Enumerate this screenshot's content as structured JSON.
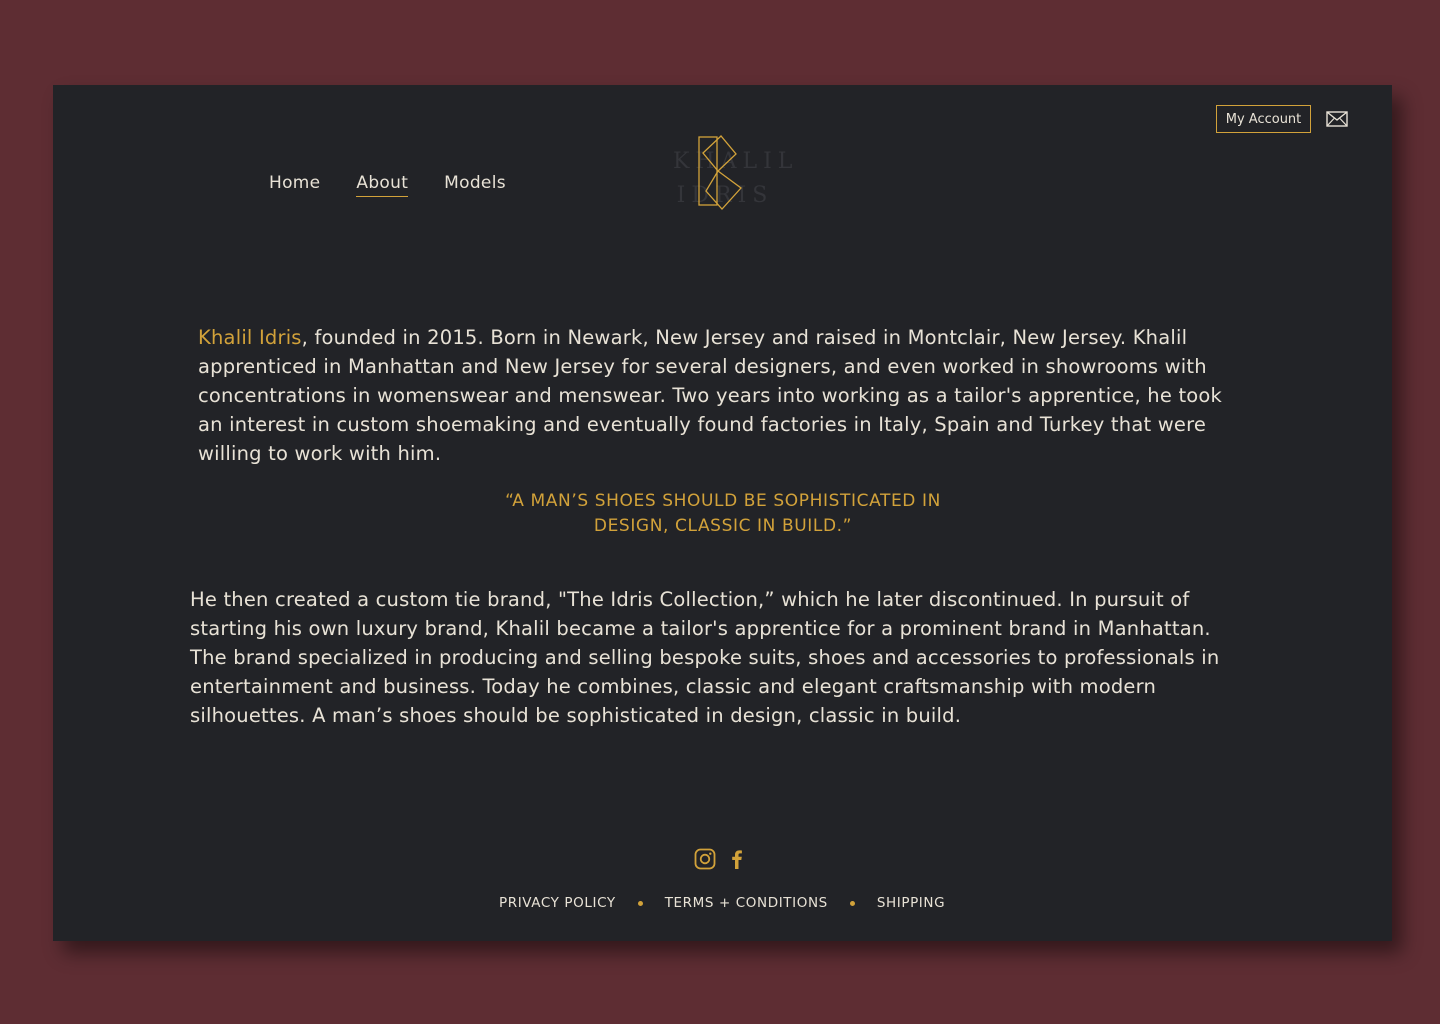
{
  "header": {
    "account_label": "My Account",
    "mail_icon": "mail-icon",
    "logo_text_line1": "KHALIL",
    "logo_text_line2": "IDRIS"
  },
  "nav": {
    "items": [
      {
        "label": "Home",
        "active": false
      },
      {
        "label": "About",
        "active": true
      },
      {
        "label": "Models",
        "active": false
      }
    ]
  },
  "content": {
    "name_link": "Khalil Idris",
    "para1_rest": ", founded in 2015. Born in Newark, New Jersey and raised in Montclair, New Jersey. Khalil apprenticed in Manhattan and New Jersey for several designers, and even worked in showrooms with concentrations in womenswear and menswear. Two years into working as a tailor's apprentice, he took an interest in custom shoemaking and eventually found factories in Italy, Spain and Turkey that were willing to work with him.",
    "quote": "“A MAN’S SHOES SHOULD BE SOPHISTICATED IN DESIGN, CLASSIC IN BUILD.”",
    "para2": "He then created a custom tie brand, \"The Idris Collection,” which he later discontinued. In pursuit of starting his own luxury brand, Khalil became a tailor's apprentice for a prominent brand in Manhattan. The brand specialized in producing and selling bespoke suits, shoes and accessories to professionals in entertainment and business. Today he combines, classic and elegant craftsmanship with modern silhouettes. A man’s shoes should be sophisticated in design, classic in build."
  },
  "footer": {
    "social": [
      "instagram-icon",
      "facebook-icon"
    ],
    "links": {
      "privacy": "PRIVACY POLICY",
      "terms": "TERMS + CONDITIONS",
      "shipping": "SHIPPING"
    }
  },
  "colors": {
    "background": "#5e2d33",
    "panel": "#222327",
    "accent": "#d2a23a",
    "text": "#e8e2d6"
  }
}
